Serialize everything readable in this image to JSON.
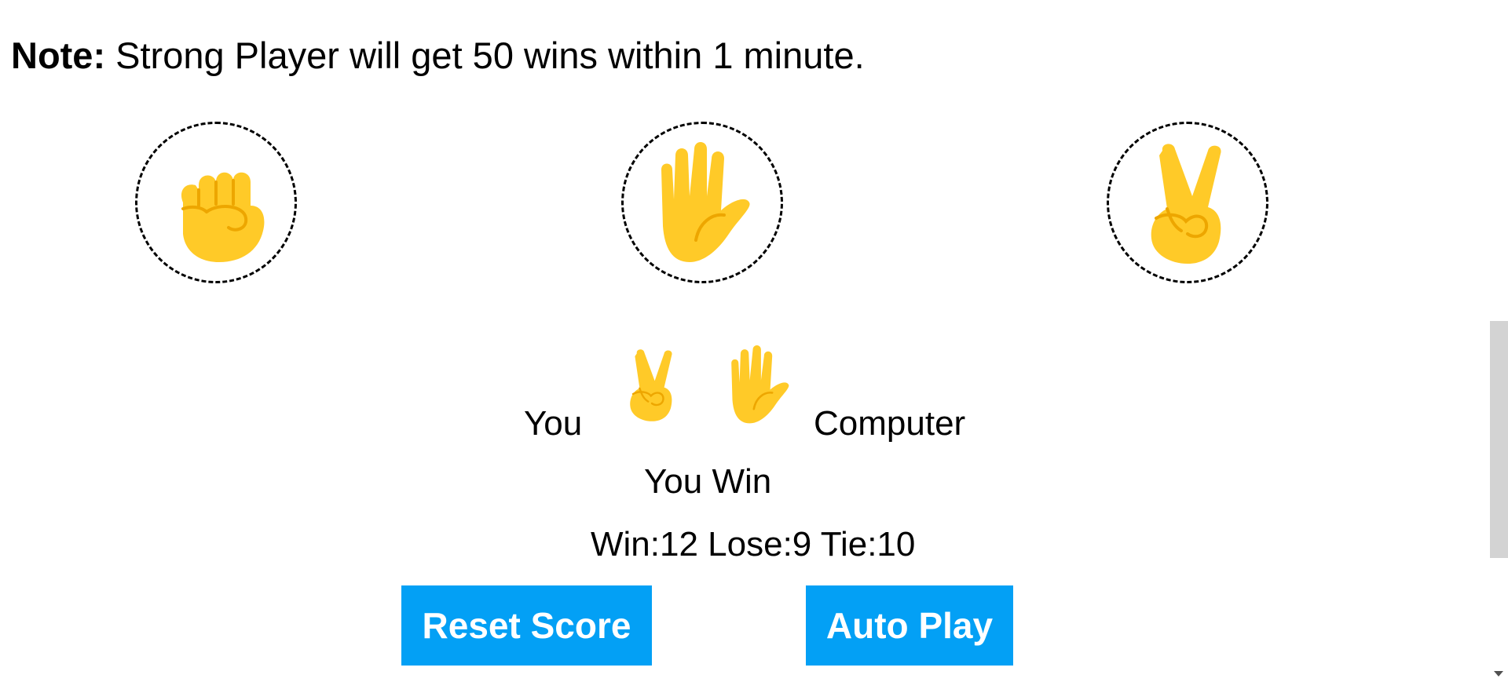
{
  "note": {
    "label": "Note:",
    "text": " Strong Player will get 50 wins within 1 minute."
  },
  "choices": [
    {
      "name": "Rock",
      "icon": "fist-icon"
    },
    {
      "name": "Paper",
      "icon": "raised-hand-icon"
    },
    {
      "name": "Scissors",
      "icon": "victory-hand-icon"
    }
  ],
  "result": {
    "you_label": "You",
    "computer_label": "Computer",
    "player_move_icon": "victory-hand-icon",
    "computer_move_icon": "raised-hand-icon",
    "outcome": "You Win"
  },
  "score": {
    "text": "Win:12 Lose:9 Tie:10",
    "wins": 12,
    "losses": 9,
    "ties": 10
  },
  "buttons": {
    "reset_label": "Reset Score",
    "auto_play_label": "Auto Play"
  },
  "colors": {
    "button_bg": "#03a0f5",
    "button_text": "#ffffff",
    "emoji_yellow": "#FFCA28",
    "emoji_line": "#EDA600"
  }
}
